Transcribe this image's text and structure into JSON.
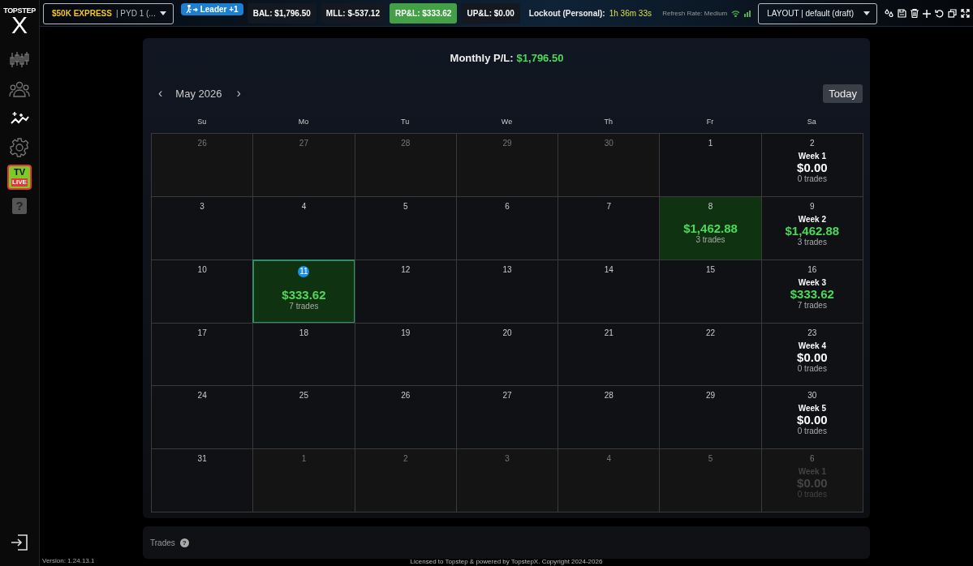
{
  "brand": {
    "name": "TOPSTEP",
    "mark": "X"
  },
  "topbar": {
    "account": {
      "plan": "$50K EXPRESS",
      "name": "| PYD 1 (..."
    },
    "leader": "Leader +1",
    "stats": [
      {
        "label": "BAL: $1,796.50",
        "highlight": false
      },
      {
        "label": "MLL: $-537.12",
        "highlight": false
      },
      {
        "label": "RP&L: $333.62",
        "highlight": true
      },
      {
        "label": "UP&L: $0.00",
        "highlight": false
      }
    ],
    "lockout": {
      "label": "Lockout (Personal):",
      "value": "1h 36m 33s"
    },
    "refresh": "Refresh Rate: Medium",
    "layout": "LAYOUT | default (draft)"
  },
  "sidebar": {
    "items": [
      {
        "kind": "candles",
        "selected": false
      },
      {
        "kind": "people",
        "selected": false
      },
      {
        "kind": "sparkle",
        "selected": true
      },
      {
        "kind": "gear",
        "selected": false
      },
      {
        "kind": "tv",
        "selected": false,
        "text": "TV",
        "badge": "LIVE"
      },
      {
        "kind": "help",
        "selected": false,
        "text": "?"
      }
    ]
  },
  "summary": {
    "label": "Monthly P/L:",
    "value": "$1,796.50"
  },
  "calendar": {
    "month": "May 2026",
    "prev": "‹",
    "next": "›",
    "today_button": "Today",
    "weekdays": [
      "Su",
      "Mo",
      "Tu",
      "We",
      "Th",
      "Fr",
      "Sa"
    ],
    "weeks": [
      {
        "days": [
          {
            "day": "26",
            "outside": true,
            "today": false
          },
          {
            "day": "27",
            "outside": true,
            "today": false
          },
          {
            "day": "28",
            "outside": true,
            "today": false
          },
          {
            "day": "29",
            "outside": true,
            "today": false
          },
          {
            "day": "30",
            "outside": true,
            "today": false
          },
          {
            "day": "1",
            "outside": false,
            "today": false
          }
        ],
        "summary": {
          "day": "2",
          "outside": false,
          "week": "Week 1",
          "pnl": "$0.00",
          "trades": "0 trades",
          "profit": false
        }
      },
      {
        "days": [
          {
            "day": "3",
            "outside": false,
            "today": false
          },
          {
            "day": "4",
            "outside": false,
            "today": false
          },
          {
            "day": "5",
            "outside": false,
            "today": false
          },
          {
            "day": "6",
            "outside": false,
            "today": false
          },
          {
            "day": "7",
            "outside": false,
            "today": false
          },
          {
            "day": "8",
            "outside": false,
            "today": false,
            "pnl": "$1,462.88",
            "trades": "3 trades",
            "profit": true
          }
        ],
        "summary": {
          "day": "9",
          "outside": false,
          "week": "Week 2",
          "pnl": "$1,462.88",
          "trades": "3 trades",
          "profit": true
        }
      },
      {
        "days": [
          {
            "day": "10",
            "outside": false,
            "today": false
          },
          {
            "day": "11",
            "outside": false,
            "today": true,
            "pnl": "$333.62",
            "trades": "7 trades",
            "profit": true
          },
          {
            "day": "12",
            "outside": false,
            "today": false
          },
          {
            "day": "13",
            "outside": false,
            "today": false
          },
          {
            "day": "14",
            "outside": false,
            "today": false
          },
          {
            "day": "15",
            "outside": false,
            "today": false
          }
        ],
        "summary": {
          "day": "16",
          "outside": false,
          "week": "Week 3",
          "pnl": "$333.62",
          "trades": "7 trades",
          "profit": true
        }
      },
      {
        "days": [
          {
            "day": "17",
            "outside": false,
            "today": false
          },
          {
            "day": "18",
            "outside": false,
            "today": false
          },
          {
            "day": "19",
            "outside": false,
            "today": false
          },
          {
            "day": "20",
            "outside": false,
            "today": false
          },
          {
            "day": "21",
            "outside": false,
            "today": false
          },
          {
            "day": "22",
            "outside": false,
            "today": false
          }
        ],
        "summary": {
          "day": "23",
          "outside": false,
          "week": "Week 4",
          "pnl": "$0.00",
          "trades": "0 trades",
          "profit": false
        }
      },
      {
        "days": [
          {
            "day": "24",
            "outside": false,
            "today": false
          },
          {
            "day": "25",
            "outside": false,
            "today": false
          },
          {
            "day": "26",
            "outside": false,
            "today": false
          },
          {
            "day": "27",
            "outside": false,
            "today": false
          },
          {
            "day": "28",
            "outside": false,
            "today": false
          },
          {
            "day": "29",
            "outside": false,
            "today": false
          }
        ],
        "summary": {
          "day": "30",
          "outside": false,
          "week": "Week 5",
          "pnl": "$0.00",
          "trades": "0 trades",
          "profit": false
        }
      },
      {
        "days": [
          {
            "day": "31",
            "outside": false,
            "today": false
          },
          {
            "day": "1",
            "outside": true,
            "today": false
          },
          {
            "day": "2",
            "outside": true,
            "today": false
          },
          {
            "day": "3",
            "outside": true,
            "today": false
          },
          {
            "day": "4",
            "outside": true,
            "today": false
          },
          {
            "day": "5",
            "outside": true,
            "today": false
          }
        ],
        "summary": {
          "day": "6",
          "outside": true,
          "week": "Week 1",
          "pnl": "$0.00",
          "trades": "0 trades",
          "profit": false
        }
      }
    ]
  },
  "trades": {
    "title": "Trades",
    "help": "?"
  },
  "footer": {
    "version": "Version: 1.24.13.1",
    "copyright": "Licensed to Topstep & powered by TopstepX. Copyright 2024-2026"
  }
}
